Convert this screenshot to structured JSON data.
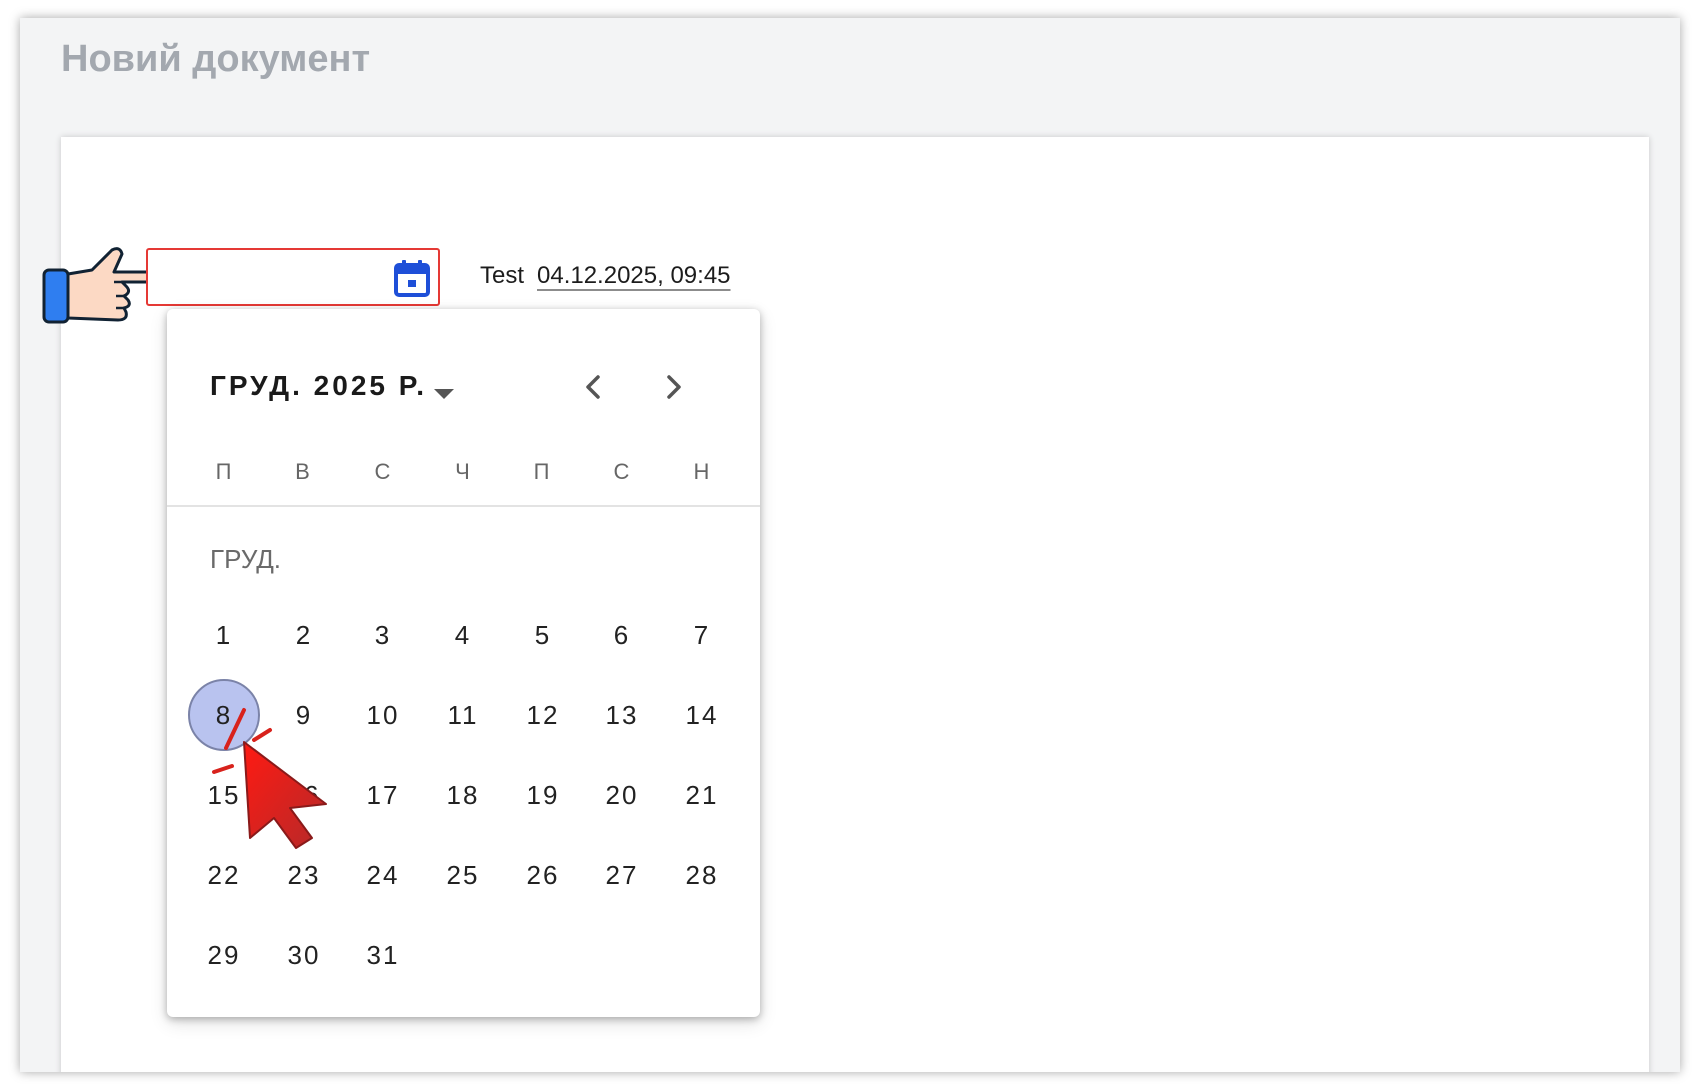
{
  "window": {
    "title": "Новий документ"
  },
  "form": {
    "date_input_value": "",
    "field_label": "Test",
    "field_value": "04.12.2025, 09:45"
  },
  "datepicker": {
    "header_label": "ГРУД. 2025 Р.",
    "weekdays": [
      "П",
      "В",
      "С",
      "Ч",
      "П",
      "С",
      "Н"
    ],
    "month_label": "ГРУД.",
    "weeks": [
      [
        "1",
        "2",
        "3",
        "4",
        "5",
        "6",
        "7"
      ],
      [
        "8",
        "9",
        "10",
        "11",
        "12",
        "13",
        "14"
      ],
      [
        "15",
        "16",
        "17",
        "18",
        "19",
        "20",
        "21"
      ],
      [
        "22",
        "23",
        "24",
        "25",
        "26",
        "27",
        "28"
      ],
      [
        "29",
        "30",
        "31"
      ]
    ],
    "hovered_day": "8"
  },
  "colors": {
    "field_error_border": "#e53935",
    "calendar_icon": "#1e4fd8",
    "hover_day": "#b9c3ef",
    "cursor_arrow": "#e8211c"
  },
  "icons": {
    "pointer_hand": "pointing-hand-icon",
    "calendar": "calendar-icon",
    "dropdown": "caret-down-icon",
    "prev": "chevron-left-icon",
    "next": "chevron-right-icon",
    "cursor": "mouse-cursor-arrow-icon"
  }
}
